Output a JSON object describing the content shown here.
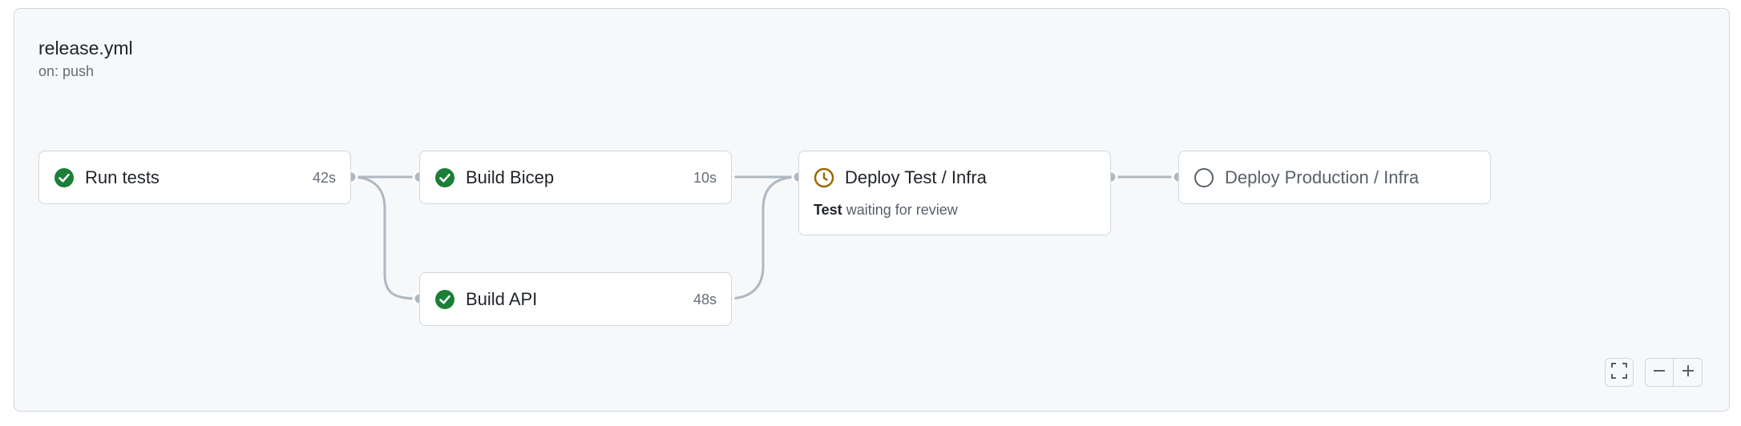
{
  "workflow": {
    "title": "release.yml",
    "trigger": "on: push"
  },
  "jobs": [
    {
      "name": "Run tests",
      "duration": "42s",
      "status": "success"
    },
    {
      "name": "Build Bicep",
      "duration": "10s",
      "status": "success"
    },
    {
      "name": "Build API",
      "duration": "48s",
      "status": "success"
    },
    {
      "name": "Deploy Test / Infra",
      "status": "waiting",
      "env": "Test",
      "note": "waiting for review"
    },
    {
      "name": "Deploy Production / Infra",
      "status": "pending"
    }
  ],
  "colors": {
    "success": "#1a7f37",
    "waiting": "#9a6700",
    "pending": "#57606a",
    "edge": "#afb8c1"
  },
  "icons": {
    "success": "check-circle-icon",
    "waiting": "clock-icon",
    "pending": "circle-icon",
    "fullscreen": "fullscreen-icon",
    "zoom_out": "minus-icon",
    "zoom_in": "plus-icon"
  }
}
